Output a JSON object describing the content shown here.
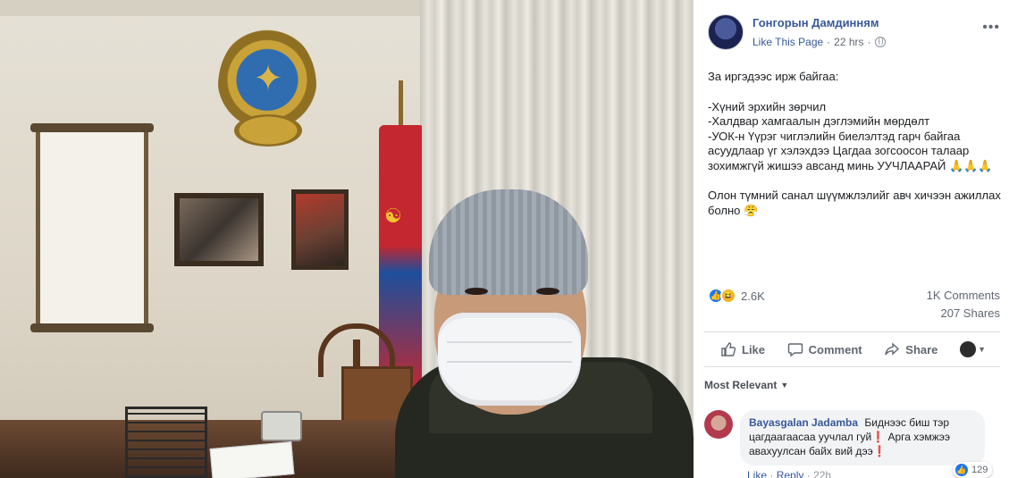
{
  "post": {
    "author": "Гонгорын Дамдинням",
    "like_page_label": "Like This Page",
    "separator": "·",
    "time": "22 hrs",
    "privacy_icon": "globe-icon",
    "more_label": "•••",
    "text": {
      "line1": "За иргэдээс ирж байгаа:",
      "line2": "-Хүний эрхийн зөрчил",
      "line3": "-Халдвар хамгаалын дэглэмийн мөрдөлт",
      "line4": "-УОК-н Үүрэг чиглэлийн биелэлтэд гарч байгаа асуудлаар үг хэлэхдээ Цагдаа зогсоосон талаар зохимжгүй жишээ авсанд минь УУЧЛААРАЙ 🙏🙏🙏",
      "line5": "Олон түмний санал шүүмжлэлийг авч хичээн ажиллах болно 😤"
    }
  },
  "stats": {
    "reaction_icons": [
      "like-icon",
      "haha-icon"
    ],
    "like_glyph": "👍",
    "haha_glyph": "😆",
    "reaction_count": "2.6K",
    "comments_count": "1K Comments",
    "shares_count": "207 Shares"
  },
  "actions": {
    "like_label": "Like",
    "comment_label": "Comment",
    "share_label": "Share"
  },
  "comments_section": {
    "sort_label": "Most Relevant",
    "comment": {
      "author": "Bayasgalan Jadamba",
      "text": "Биднээс биш тэр цагдаагаасаа уучлал гуй❗ Арга хэмжээ авахуулсан байх вий дээ❗",
      "reaction_count": "129",
      "like_label": "Like",
      "reply_label": "Reply",
      "time": "22h"
    }
  },
  "colors": {
    "link_blue": "#385898",
    "like_blue": "#1877f2",
    "haha_yellow": "#f7b125",
    "text_gray": "#606770"
  }
}
